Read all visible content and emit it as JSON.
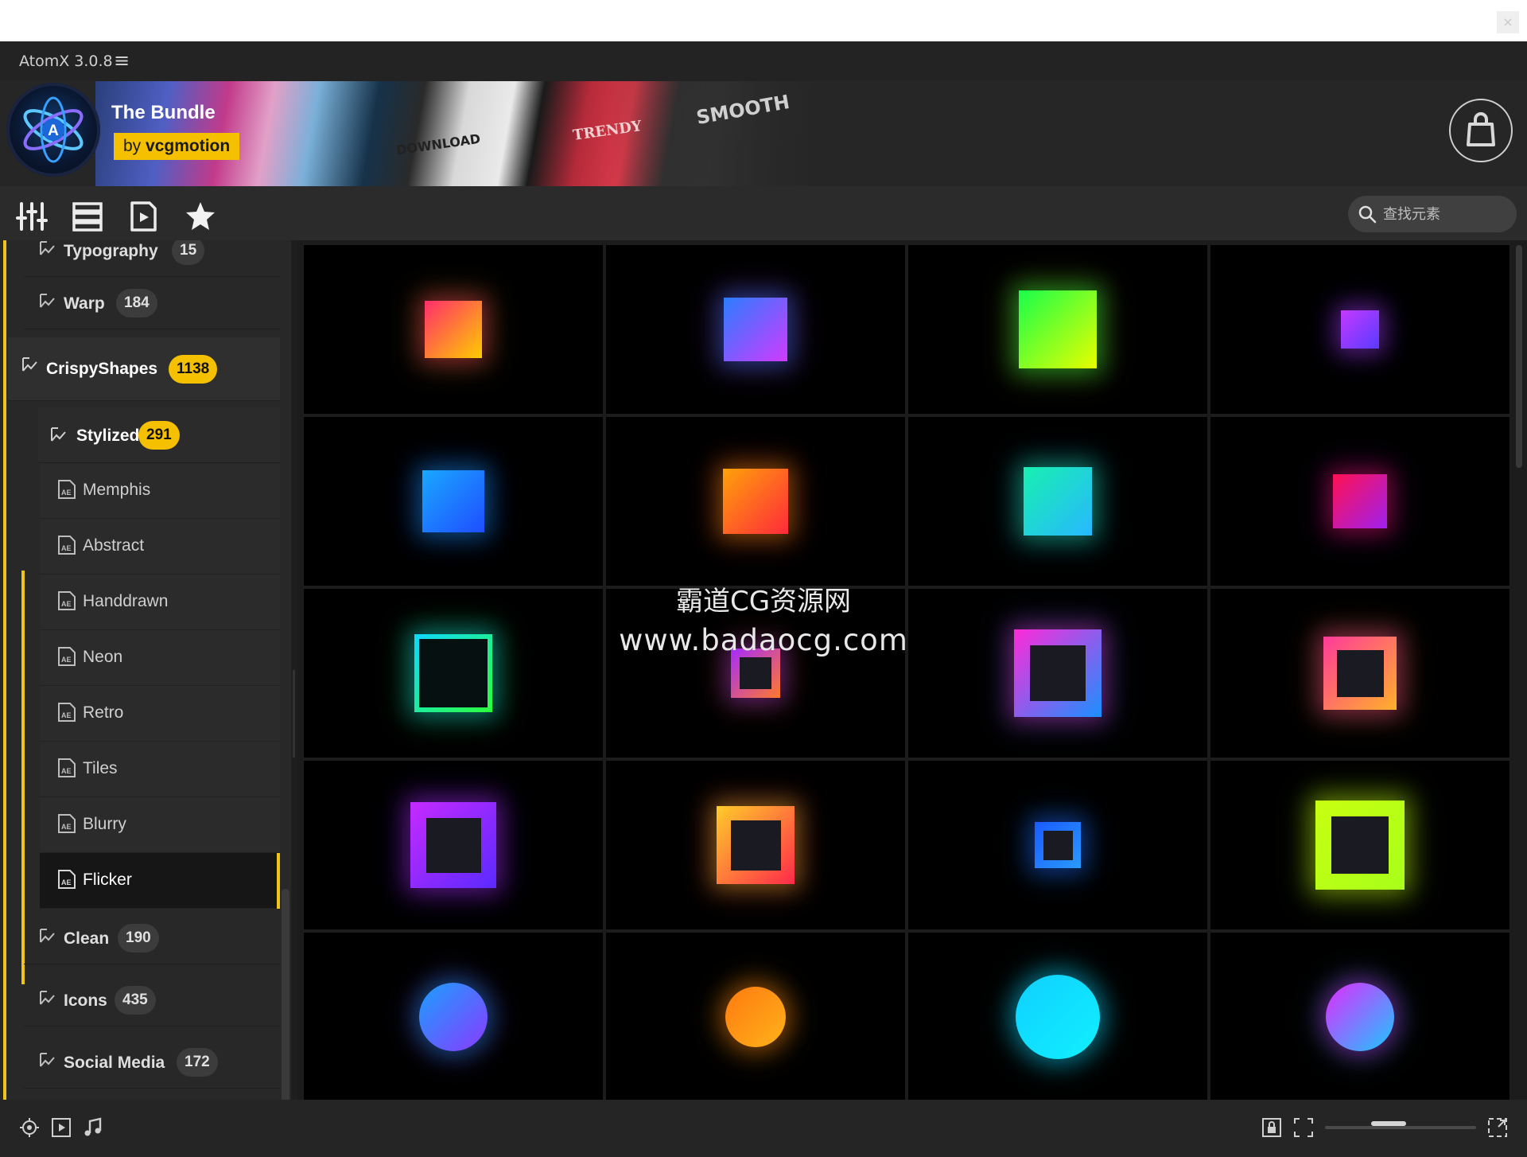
{
  "window": {
    "close_label": "×"
  },
  "app": {
    "title": "AtomX 3.0.8",
    "menu_icon": "hamburger-icon"
  },
  "banner": {
    "title": "The Bundle",
    "subtitle_prefix": "by ",
    "subtitle_brand": "vcgmotion",
    "art_texts": [
      "DOWNLOAD",
      "TRENDY",
      "SMOOTH"
    ],
    "cart_icon": "shopping-bag-icon",
    "brand_color": "#f5c000"
  },
  "toolbar": {
    "buttons": [
      {
        "icon": "sliders-icon"
      },
      {
        "icon": "list-icon"
      },
      {
        "icon": "media-file-icon"
      },
      {
        "icon": "star-icon"
      }
    ],
    "search": {
      "placeholder": "查找元素",
      "value": ""
    }
  },
  "sidebar": {
    "top_items": [
      {
        "label": "Typography",
        "count": "15"
      },
      {
        "label": "Warp",
        "count": "184"
      }
    ],
    "parent": {
      "label": "CrispyShapes",
      "count": "1138"
    },
    "child": {
      "label": "Stylized",
      "count": "291"
    },
    "leaves": [
      "Memphis",
      "Abstract",
      "Handdrawn",
      "Neon",
      "Retro",
      "Tiles",
      "Blurry",
      "Flicker"
    ],
    "active_leaf": "Flicker",
    "bottom_items": [
      {
        "label": "Clean",
        "count": "190"
      },
      {
        "label": "Icons",
        "count": "435"
      },
      {
        "label": "Social Media",
        "count": "172"
      }
    ],
    "accent_color": "#f0c419"
  },
  "grid": {
    "columns": 4,
    "rows": 5,
    "items": [
      {
        "kind": "square",
        "colors": [
          "#ff2d6b",
          "#ffcc00"
        ]
      },
      {
        "kind": "square",
        "colors": [
          "#2a7dff",
          "#d13aff"
        ]
      },
      {
        "kind": "square",
        "colors": [
          "#18ff4a",
          "#e8ff00"
        ]
      },
      {
        "kind": "square",
        "colors": [
          "#c43aff",
          "#5a3aff"
        ]
      },
      {
        "kind": "square",
        "colors": [
          "#1aa8ff",
          "#1f4dff"
        ]
      },
      {
        "kind": "square",
        "colors": [
          "#ffa10a",
          "#ff2a3a"
        ]
      },
      {
        "kind": "square",
        "colors": [
          "#18f0b0",
          "#27b8ff"
        ]
      },
      {
        "kind": "square",
        "colors": [
          "#ff1050",
          "#a020f0"
        ]
      },
      {
        "kind": "frame",
        "colors": [
          "#10d8ff",
          "#2bff3a"
        ]
      },
      {
        "kind": "frame",
        "colors": [
          "#a52aff",
          "#ff7a2a"
        ]
      },
      {
        "kind": "frame",
        "colors": [
          "#ff2ad8",
          "#1a90ff"
        ]
      },
      {
        "kind": "frame",
        "colors": [
          "#ff3a9a",
          "#ffb02a"
        ]
      },
      {
        "kind": "frame",
        "colors": [
          "#c62aff",
          "#5a2aff"
        ]
      },
      {
        "kind": "frame",
        "colors": [
          "#ffcc2a",
          "#ff2a4a"
        ]
      },
      {
        "kind": "frame",
        "colors": [
          "#1a5aff",
          "#2a9aff"
        ]
      },
      {
        "kind": "frame",
        "colors": [
          "#c8ff10",
          "#a8ff1a"
        ]
      },
      {
        "kind": "circle",
        "colors": [
          "#1aa0ff",
          "#8a3aff"
        ]
      },
      {
        "kind": "circle",
        "colors": [
          "#ff7a10",
          "#ffb21a"
        ]
      },
      {
        "kind": "circle",
        "colors": [
          "#10d0ff",
          "#10f0ff"
        ]
      },
      {
        "kind": "circle",
        "colors": [
          "#e22aff",
          "#1ac8ff"
        ]
      }
    ]
  },
  "watermark": {
    "line1": "霸道CG资源网",
    "line2": "www.badaocg.com"
  },
  "bottom_bar": {
    "left_icons": [
      "target-icon",
      "play-icon",
      "music-icon"
    ],
    "right_icons": [
      "lock-icon",
      "fit-icon",
      "expand-icon"
    ],
    "zoom_level": 0.35
  }
}
